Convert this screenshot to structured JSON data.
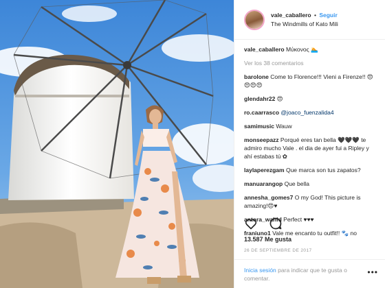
{
  "post": {
    "username": "vale_caballero",
    "follow_label": "Seguir",
    "location": "The Windmills of Kato Mili",
    "caption_text": "Μύκονος 🏊",
    "view_all_comments": "Ver los 38 comentarios"
  },
  "comments": [
    {
      "user": "barolone",
      "text": "Come to Florence!!! Vieni a Firenze!! 😍😍😍😍"
    },
    {
      "user": "glendahr22",
      "text": "😍"
    },
    {
      "user": "ro.caarrasco",
      "mention": "@joaco_fuenzalida4",
      "text": ""
    },
    {
      "user": "samimusic",
      "text": "Wauw"
    },
    {
      "user": "monseepazz",
      "text": "Porqué eres tan bella 🖤🖤🖤 te admiro mucho Vale . el dia de ayer fui a Ripley y ahí estabas tú ✿"
    },
    {
      "user": "laylaperezgam",
      "text": "Que marca son tus zapatos?"
    },
    {
      "user": "manuarangop",
      "text": "Que bella"
    },
    {
      "user": "annesha_gomes7",
      "text": "O my God! This picture is amazing!😍♥"
    },
    {
      "user": "antora_wahid",
      "text": "Perfect ♥♥♥"
    },
    {
      "user": "franiuno1",
      "text": "Vale me encanto tu outfit!! 🐾 no"
    }
  ],
  "likes_text": "13.587 Me gusta",
  "date_text": "26 DE SEPTIEMBRE DE 2017",
  "login_bar": {
    "link": "Inicia sesión",
    "text": "para indicar que te gusta o comentar."
  },
  "icons": {
    "like": "heart-icon",
    "comment": "comment-bubble-icon",
    "more": "more-dots-icon"
  },
  "colors": {
    "link_blue": "#3897f0",
    "mention_blue": "#003569",
    "muted": "#999999",
    "sky": "#4a8fd6"
  }
}
